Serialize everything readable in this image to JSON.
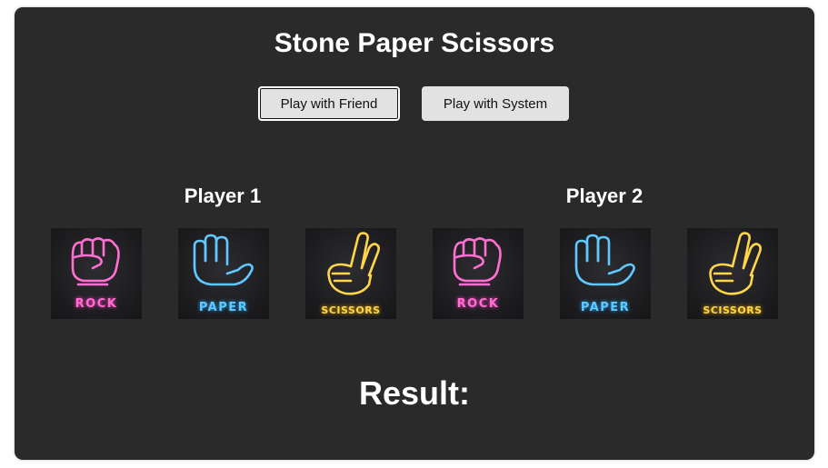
{
  "title": "Stone Paper Scissors",
  "buttons": {
    "friend_label": "Play with Friend",
    "system_label": "Play with System"
  },
  "players": [
    {
      "name": "Player 1",
      "choices": [
        "ROCK",
        "PAPER",
        "SCISSORS"
      ]
    },
    {
      "name": "Player 2",
      "choices": [
        "ROCK",
        "PAPER",
        "SCISSORS"
      ]
    }
  ],
  "result": {
    "label": "Result:"
  },
  "colors": {
    "panel": "#2a2a2a",
    "button": "#e2e2e2",
    "rock_neon": "#ff6fd2",
    "paper_neon": "#5fc8ff",
    "scissors_neon": "#ffd54a"
  },
  "icons": {
    "rock": "fist-icon",
    "paper": "open-hand-icon",
    "scissors": "victory-hand-icon"
  }
}
